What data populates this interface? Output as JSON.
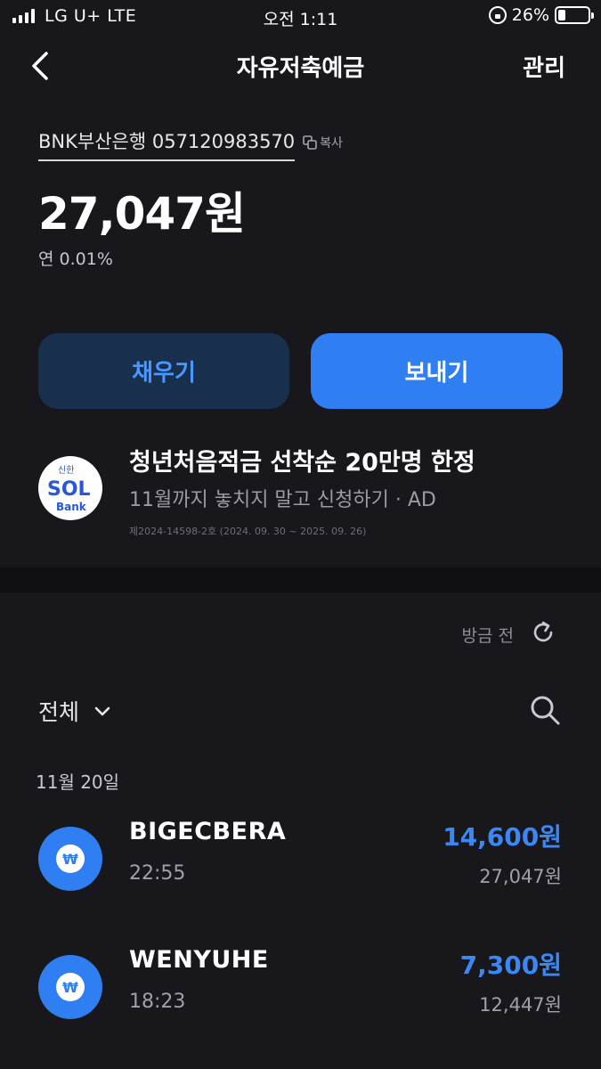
{
  "status_bar": {
    "carrier": "LG U+   LTE",
    "time": "오전 1:11",
    "battery_percent": "26%",
    "battery_level": 0.26,
    "signal_bars": 4
  },
  "header": {
    "back_icon": "chevron-left-icon",
    "title": "자유저축예금",
    "manage_label": "관리"
  },
  "account": {
    "number": "BNK부산은행 057120983570",
    "copy_label": "복사",
    "balance": "27,047원",
    "rate": "연 0.01%"
  },
  "actions": {
    "fill_label": "채우기",
    "send_label": "보내기"
  },
  "ad": {
    "logo_top": "신한",
    "logo_main": "SOL",
    "logo_sub": "Bank",
    "title": "청년처음적금 선착순 20만명 한정",
    "subtitle": "11월까지 놓치지 말고 신청하기 · AD",
    "fine_print": "제2024-14598-2호 (2024. 09. 30 ~ 2025. 09. 26)"
  },
  "transactions": {
    "refresh_label": "방금 전",
    "filter_label": "전체",
    "date_header": "11월 20일",
    "items": [
      {
        "name": "BIGECBERA",
        "time": "22:55",
        "amount": "14,600원",
        "balance": "27,047원",
        "icon_text": "₩"
      },
      {
        "name": "WENYUHE",
        "time": "18:23",
        "amount": "7,300원",
        "balance": "12,447원",
        "icon_text": "₩"
      }
    ]
  },
  "colors": {
    "background": "#17171c",
    "accent": "#2f7ff2",
    "amount_blue": "#3b88f5",
    "fill_button_bg": "#182f4d"
  }
}
